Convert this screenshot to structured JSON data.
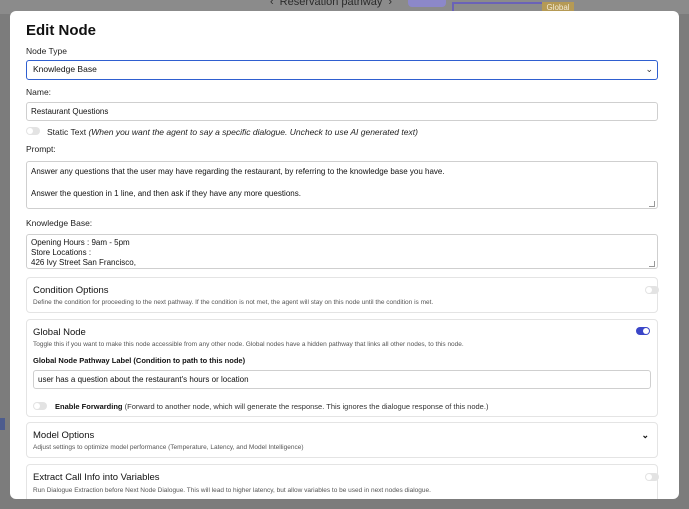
{
  "backdrop": {
    "pathway_label": "Reservation pathway",
    "orange_label": "Global"
  },
  "modal": {
    "title": "Edit Node",
    "node_type_label": "Node Type",
    "node_type_value": "Knowledge Base",
    "name_label": "Name:",
    "name_value": "Restaurant Questions",
    "static_text_label": "Static Text",
    "static_text_hint": "(When you want the agent to say a specific dialogue. Uncheck to use AI generated text)",
    "prompt_label": "Prompt:",
    "prompt_lines": [
      "Answer any questions that the user may have regarding the restaurant, by referring to the knowledge base you have.",
      "",
      "Answer the question in 1 line, and then ask if they have any more questions."
    ],
    "kb_label": "Knowledge Base:",
    "kb_lines": [
      "Opening Hours : 9am - 5pm",
      "Store Locations :",
      "426 Ivy Street San Francisco,"
    ],
    "condition": {
      "title": "Condition Options",
      "desc": "Define the condition for proceeding to the next pathway. If the condition is not met, the agent will stay on this node until the condition is met."
    },
    "global_node": {
      "title": "Global Node",
      "desc": "Toggle this if you want to make this node accessible from any other node. Global nodes have a hidden pathway that links all other nodes, to this node.",
      "pathway_label": "Global Node Pathway Label (Condition to path to this node)",
      "pathway_value": "user has a question about the restaurant's hours or location",
      "forwarding_label": "Enable Forwarding",
      "forwarding_hint": "(Forward to another node, which will generate the response. This ignores the dialogue response of this node.)"
    },
    "model_options": {
      "title": "Model Options",
      "desc": "Adjust settings to optimize model performance (Temperature, Latency, and Model Intelligence)"
    },
    "extract": {
      "title": "Extract Call Info into Variables",
      "desc": "Run Dialogue Extraction before Next Node Dialogue. This will lead to higher latency, but allow variables to be used in next nodes dialogue."
    }
  },
  "colors": {
    "accent": "#3b46c8",
    "select_border": "#2f5fd0"
  }
}
